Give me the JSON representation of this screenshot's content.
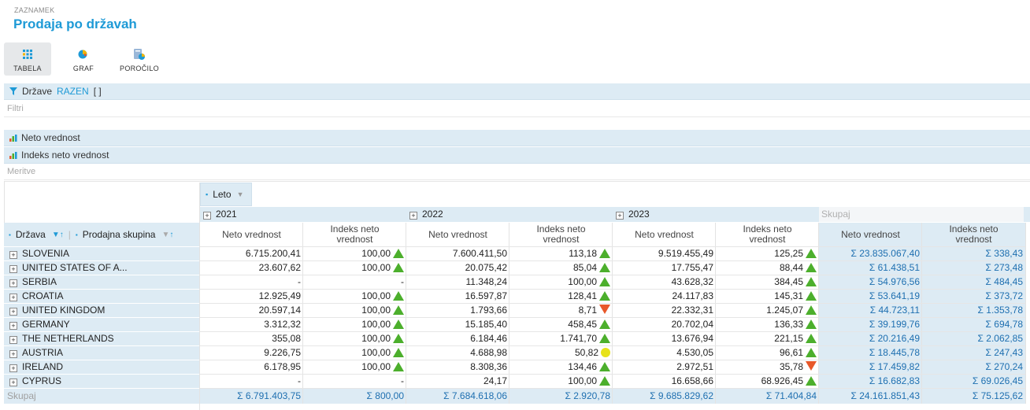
{
  "header": {
    "crumb": "ZAZNAMEK",
    "title": "Prodaja po državah"
  },
  "toolbar": {
    "tabela": "TABELA",
    "graf": "GRAF",
    "porocilo": "POROČILO"
  },
  "filter_band": {
    "field": "Države",
    "link": "RAZEN",
    "bracket": "[ ]",
    "placeholder": "Filtri"
  },
  "measures": {
    "m1": "Neto vrednost",
    "m2": "Indeks neto vrednost",
    "placeholder": "Meritve"
  },
  "pivot": {
    "col_field": "Leto",
    "row_field1": "Država",
    "row_field2": "Prodajna skupina",
    "years": [
      "2021",
      "2022",
      "2023"
    ],
    "total_label": "Skupaj",
    "col_net": "Neto vrednost",
    "col_idx": "Indeks neto vrednost",
    "rows": [
      {
        "country": "SLOVENIA",
        "v": [
          "6.715.200,41",
          "100,00",
          "7.600.411,50",
          "113,18",
          "9.519.455,49",
          "125,25",
          "Σ 23.835.067,40",
          "Σ 338,43"
        ],
        "s": [
          "up",
          "up",
          "up"
        ]
      },
      {
        "country": "UNITED STATES OF A...",
        "v": [
          "23.607,62",
          "100,00",
          "20.075,42",
          "85,04",
          "17.755,47",
          "88,44",
          "Σ 61.438,51",
          "Σ 273,48"
        ],
        "s": [
          "up",
          "up",
          "up"
        ]
      },
      {
        "country": "SERBIA",
        "v": [
          "-",
          "-",
          "11.348,24",
          "100,00",
          "43.628,32",
          "384,45",
          "Σ 54.976,56",
          "Σ 484,45"
        ],
        "s": [
          "",
          "up",
          "up"
        ]
      },
      {
        "country": "CROATIA",
        "v": [
          "12.925,49",
          "100,00",
          "16.597,87",
          "128,41",
          "24.117,83",
          "145,31",
          "Σ 53.641,19",
          "Σ 373,72"
        ],
        "s": [
          "up",
          "up",
          "up"
        ]
      },
      {
        "country": "UNITED KINGDOM",
        "v": [
          "20.597,14",
          "100,00",
          "1.793,66",
          "8,71",
          "22.332,31",
          "1.245,07",
          "Σ 44.723,11",
          "Σ 1.353,78"
        ],
        "s": [
          "up",
          "down",
          "up"
        ]
      },
      {
        "country": "GERMANY",
        "v": [
          "3.312,32",
          "100,00",
          "15.185,40",
          "458,45",
          "20.702,04",
          "136,33",
          "Σ 39.199,76",
          "Σ 694,78"
        ],
        "s": [
          "up",
          "up",
          "up"
        ]
      },
      {
        "country": "THE NETHERLANDS",
        "v": [
          "355,08",
          "100,00",
          "6.184,46",
          "1.741,70",
          "13.676,94",
          "221,15",
          "Σ 20.216,49",
          "Σ 2.062,85"
        ],
        "s": [
          "up",
          "up",
          "up"
        ]
      },
      {
        "country": "AUSTRIA",
        "v": [
          "9.226,75",
          "100,00",
          "4.688,98",
          "50,82",
          "4.530,05",
          "96,61",
          "Σ 18.445,78",
          "Σ 247,43"
        ],
        "s": [
          "up",
          "circle",
          "up"
        ]
      },
      {
        "country": "IRELAND",
        "v": [
          "6.178,95",
          "100,00",
          "8.308,36",
          "134,46",
          "2.972,51",
          "35,78",
          "Σ 17.459,82",
          "Σ 270,24"
        ],
        "s": [
          "up",
          "up",
          "down"
        ]
      },
      {
        "country": "CYPRUS",
        "v": [
          "-",
          "-",
          "24,17",
          "100,00",
          "16.658,66",
          "68.926,45",
          "Σ 16.682,83",
          "Σ 69.026,45"
        ],
        "s": [
          "",
          "up",
          "up"
        ]
      }
    ],
    "totals": [
      "Σ 6.791.403,75",
      "Σ 800,00",
      "Σ 7.684.618,06",
      "Σ 2.920,78",
      "Σ 9.685.829,62",
      "Σ 71.404,84",
      "Σ 24.161.851,43",
      "Σ 75.125,62"
    ]
  },
  "colors": {
    "accent": "#1e9ad6",
    "header_band": "#ddebf4",
    "up": "#4caf2c",
    "down": "#e8582a",
    "neutral": "#e7e21a"
  },
  "icons": {
    "tabela": "table-grid-icon",
    "graf": "pie-chart-icon",
    "porocilo": "report-icon",
    "filter": "filter-icon",
    "measure": "bar-chart-icon"
  }
}
